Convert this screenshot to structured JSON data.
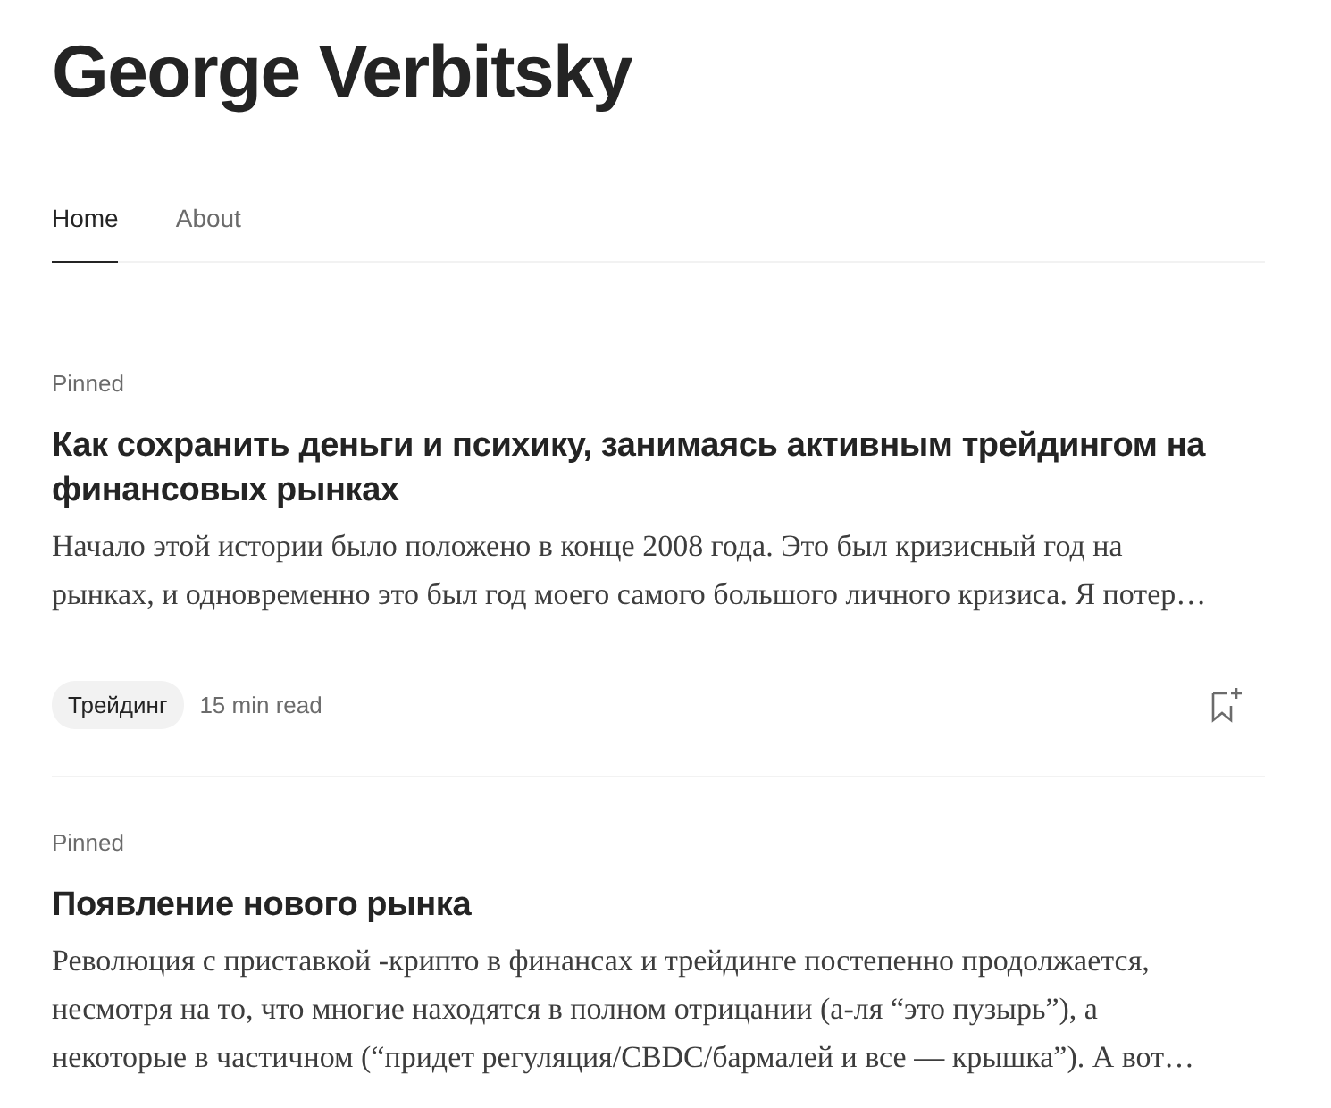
{
  "author": {
    "name": "George Verbitsky"
  },
  "tabs": [
    {
      "label": "Home",
      "selected": true
    },
    {
      "label": "About",
      "selected": false
    }
  ],
  "posts": [
    {
      "pinned_label": "Pinned",
      "title": "Как сохранить деньги и психику, занимаясь активным трейдингом на финансовых рынках",
      "excerpt_lines": [
        "Начало этой истории было положено в конце 2008 года. Это был кризисный год на",
        "рынках, и одновременно это был год моего самого большого личного кризиса. Я потер…"
      ],
      "tag": "Трейдинг",
      "read_time": "15 min read"
    },
    {
      "pinned_label": "Pinned",
      "title": "Появление нового рынка",
      "excerpt_lines": [
        "Революция с приставкой -крипто в финансах и трейдинге постепенно продолжается,",
        "несмотря на то, что многие находятся в полном отрицании (а-ля “это пузырь”), а",
        "некоторые в частичном (“придет регуляция/CBDC/бармалей и все — крышка”). А вот…"
      ]
    }
  ]
}
